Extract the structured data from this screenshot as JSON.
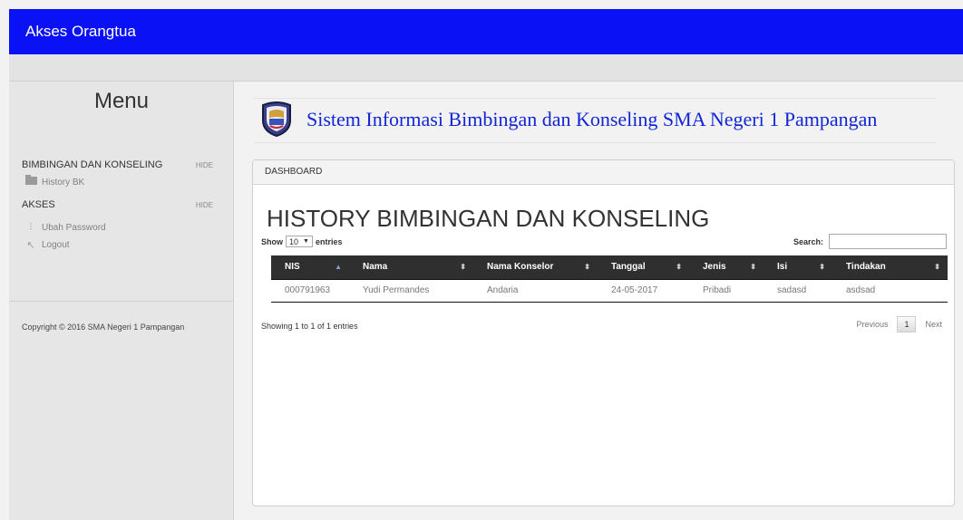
{
  "app": {
    "brand": "Akses Orangtua"
  },
  "sidebar": {
    "title": "Menu",
    "sections": [
      {
        "heading": "BIMBINGAN DAN KONSELING",
        "hide_label": "HIDE",
        "items": [
          {
            "label": "History BK",
            "icon": "folder-icon"
          }
        ]
      },
      {
        "heading": "AKSES",
        "hide_label": "HIDE",
        "items": [
          {
            "label": "Ubah Password",
            "icon": "sliders-icon"
          },
          {
            "label": "Logout",
            "icon": "arrow-up-left-icon"
          }
        ]
      }
    ],
    "copyright": "Copyright © 2016 SMA Negeri 1 Pampangan"
  },
  "header": {
    "title": "Sistem Informasi Bimbingan dan Konseling SMA Negeri 1 Pampangan",
    "logo": "school-crest-logo"
  },
  "panel": {
    "breadcrumb": "DASHBOARD",
    "heading": "HISTORY BIMBINGAN DAN KONSELING",
    "length": {
      "show": "Show",
      "value": "10",
      "entries": "entries"
    },
    "search_label": "Search:",
    "search_value": "",
    "table": {
      "columns": [
        "NIS",
        "Nama",
        "Nama Konselor",
        "Tanggal",
        "Jenis",
        "Isi",
        "Tindakan"
      ],
      "sorted_column": "NIS",
      "rows": [
        [
          "000791963",
          "Yudi Permandes",
          "Andaria",
          "24-05-2017",
          "Pribadi",
          "sadasd",
          "asdsad"
        ]
      ]
    },
    "info": "Showing 1 to 1 of 1 entries",
    "pager": {
      "previous": "Previous",
      "current": "1",
      "next": "Next"
    }
  },
  "colors": {
    "topbar": "#0a12f5",
    "title": "#1226d6",
    "table_header": "#2f2f2f"
  }
}
